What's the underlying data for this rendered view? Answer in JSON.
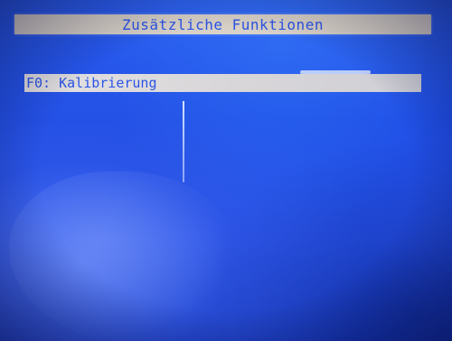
{
  "header": {
    "title": "Zusätzliche Funktionen"
  },
  "menu": {
    "items": [
      {
        "label": "F0: Kalibrierung",
        "selected": true
      }
    ]
  },
  "colors": {
    "background": "#2550e8",
    "bar": "#d9d2c7",
    "text": "#2b55e6"
  }
}
